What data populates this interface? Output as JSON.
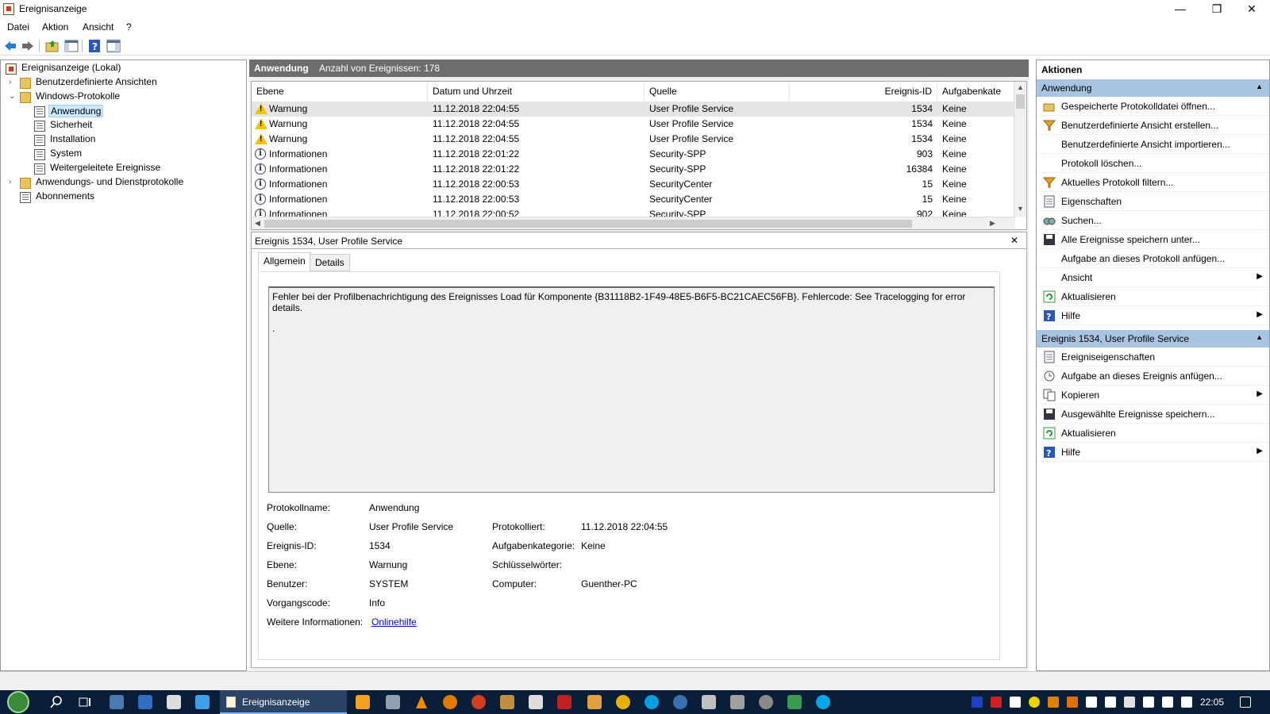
{
  "window": {
    "title": "Ereignisanzeige",
    "controls": {
      "minimize": "—",
      "restore": "❐",
      "close": "✕"
    }
  },
  "menu": [
    "Datei",
    "Aktion",
    "Ansicht",
    "?"
  ],
  "toolbar": {
    "icons": [
      "back-arrow-icon",
      "forward-arrow-icon",
      "folder-up-icon",
      "console-tree-icon",
      "help-icon",
      "action-pane-icon"
    ]
  },
  "tree": {
    "root": "Ereignisanzeige (Lokal)",
    "items": [
      {
        "label": "Benutzerdefinierte Ansichten",
        "level": 1,
        "expander": "›",
        "icon": "folder-icon"
      },
      {
        "label": "Windows-Protokolle",
        "level": 1,
        "expander": "⌄",
        "icon": "folder-icon"
      },
      {
        "label": "Anwendung",
        "level": 2,
        "selected": true,
        "icon": "log-icon"
      },
      {
        "label": "Sicherheit",
        "level": 2,
        "icon": "log-icon"
      },
      {
        "label": "Installation",
        "level": 2,
        "icon": "log-icon"
      },
      {
        "label": "System",
        "level": 2,
        "icon": "log-icon"
      },
      {
        "label": "Weitergeleitete Ereignisse",
        "level": 2,
        "icon": "log-icon"
      },
      {
        "label": "Anwendungs- und Dienstprotokolle",
        "level": 1,
        "expander": "›",
        "icon": "folder-icon"
      },
      {
        "label": "Abonnements",
        "level": 1,
        "icon": "subscription-icon"
      }
    ]
  },
  "list": {
    "header_title": "Anwendung",
    "header_count": "Anzahl von Ereignissen: 178",
    "columns": [
      "Ebene",
      "Datum und Uhrzeit",
      "Quelle",
      "Ereignis-ID",
      "Aufgabenkate"
    ],
    "rows": [
      {
        "level": "Warnung",
        "type": "warn",
        "date": "11.12.2018 22:04:55",
        "source": "User Profile Service",
        "id": "1534",
        "task": "Keine",
        "selected": true
      },
      {
        "level": "Warnung",
        "type": "warn",
        "date": "11.12.2018 22:04:55",
        "source": "User Profile Service",
        "id": "1534",
        "task": "Keine"
      },
      {
        "level": "Warnung",
        "type": "warn",
        "date": "11.12.2018 22:04:55",
        "source": "User Profile Service",
        "id": "1534",
        "task": "Keine"
      },
      {
        "level": "Informationen",
        "type": "info",
        "date": "11.12.2018 22:01:22",
        "source": "Security-SPP",
        "id": "903",
        "task": "Keine"
      },
      {
        "level": "Informationen",
        "type": "info",
        "date": "11.12.2018 22:01:22",
        "source": "Security-SPP",
        "id": "16384",
        "task": "Keine"
      },
      {
        "level": "Informationen",
        "type": "info",
        "date": "11.12.2018 22:00:53",
        "source": "SecurityCenter",
        "id": "15",
        "task": "Keine"
      },
      {
        "level": "Informationen",
        "type": "info",
        "date": "11.12.2018 22:00:53",
        "source": "SecurityCenter",
        "id": "15",
        "task": "Keine"
      },
      {
        "level": "Informationen",
        "type": "info",
        "date": "11.12.2018 22:00:52",
        "source": "Security-SPP",
        "id": "902",
        "task": "Keine"
      }
    ]
  },
  "detail": {
    "title": "Ereignis 1534, User Profile Service",
    "close": "✕",
    "tabs": [
      "Allgemein",
      "Details"
    ],
    "message": "Fehler bei der Profilbenachrichtigung des Ereignisses Load für Komponente {B31118B2-1F49-48E5-B6F5-BC21CAEC56FB}. Fehlercode: See Tracelogging for error details.",
    "message_dot": ".",
    "fields": {
      "protokollname_label": "Protokollname:",
      "protokollname": "Anwendung",
      "quelle_label": "Quelle:",
      "quelle": "User Profile Service",
      "protokolliert_label": "Protokolliert:",
      "protokolliert": "11.12.2018 22:04:55",
      "ereignisid_label": "Ereignis-ID:",
      "ereignisid": "1534",
      "aufgabenkategorie_label": "Aufgabenkategorie:",
      "aufgabenkategorie": "Keine",
      "ebene_label": "Ebene:",
      "ebene": "Warnung",
      "schluesselwoerter_label": "Schlüsselwörter:",
      "schluesselwoerter": "",
      "benutzer_label": "Benutzer:",
      "benutzer": "SYSTEM",
      "computer_label": "Computer:",
      "computer": "Guenther-PC",
      "vorgangscode_label": "Vorgangscode:",
      "vorgangscode": "Info",
      "weitere_label": "Weitere Informationen:",
      "onlinehilfe": "Onlinehilfe"
    }
  },
  "actions": {
    "title": "Aktionen",
    "section1_title": "Anwendung",
    "section1": [
      {
        "label": "Gespeicherte Protokolldatei öffnen...",
        "icon": "open-folder-icon"
      },
      {
        "label": "Benutzerdefinierte Ansicht erstellen...",
        "icon": "filter-icon"
      },
      {
        "label": "Benutzerdefinierte Ansicht importieren...",
        "icon": ""
      },
      {
        "label": "Protokoll löschen...",
        "icon": ""
      },
      {
        "label": "Aktuelles Protokoll filtern...",
        "icon": "filter-icon"
      },
      {
        "label": "Eigenschaften",
        "icon": "properties-icon"
      },
      {
        "label": "Suchen...",
        "icon": "find-icon"
      },
      {
        "label": "Alle Ereignisse speichern unter...",
        "icon": "save-icon"
      },
      {
        "label": "Aufgabe an dieses Protokoll anfügen...",
        "icon": ""
      },
      {
        "label": "Ansicht",
        "icon": "",
        "submenu": "▶"
      },
      {
        "label": "Aktualisieren",
        "icon": "refresh-icon"
      },
      {
        "label": "Hilfe",
        "icon": "help-icon",
        "submenu": "▶"
      }
    ],
    "section2_title": "Ereignis 1534, User Profile Service",
    "section2": [
      {
        "label": "Ereigniseigenschaften",
        "icon": "properties-icon"
      },
      {
        "label": "Aufgabe an dieses Ereignis anfügen...",
        "icon": "task-icon"
      },
      {
        "label": "Kopieren",
        "icon": "copy-icon",
        "submenu": "▶"
      },
      {
        "label": "Ausgewählte Ereignisse speichern...",
        "icon": "save-icon"
      },
      {
        "label": "Aktualisieren",
        "icon": "refresh-icon"
      },
      {
        "label": "Hilfe",
        "icon": "help-icon",
        "submenu": "▶"
      }
    ],
    "collapse_glyph": "▲"
  },
  "taskbar": {
    "active_app": "Ereignisanzeige",
    "clock": "22:05",
    "colors": {
      "bg": "#0b1e38",
      "active": "#2b4466"
    }
  }
}
